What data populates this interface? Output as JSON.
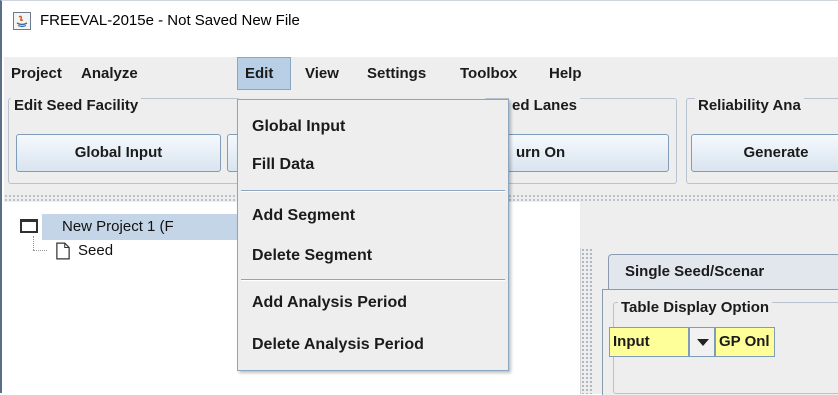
{
  "window": {
    "title": "FREEVAL-2015e - Not Saved New File"
  },
  "menubar": {
    "items": [
      {
        "label": "Project"
      },
      {
        "label": "Analyze"
      },
      {
        "label": "Edit"
      },
      {
        "label": "View"
      },
      {
        "label": "Settings"
      },
      {
        "label": "Toolbox"
      },
      {
        "label": "Help"
      }
    ],
    "active": "Edit"
  },
  "toolbar": {
    "edit_seed_group": {
      "title": "Edit Seed Facility",
      "button": "Global Input"
    },
    "managed_lanes_group": {
      "title": "ed Lanes",
      "button": "urn On"
    },
    "reliability_group": {
      "title": "Reliability Ana",
      "button": "Generate"
    }
  },
  "edit_menu": {
    "items": [
      {
        "label": "Global Input"
      },
      {
        "label": "Fill Data"
      },
      {
        "label": "Add Segment"
      },
      {
        "label": "Delete Segment"
      },
      {
        "label": "Add Analysis Period"
      },
      {
        "label": "Delete Analysis Period"
      }
    ]
  },
  "tree": {
    "project": "New Project 1 (F",
    "seed": "Seed"
  },
  "right_panel": {
    "tab": "Single Seed/Scenar",
    "options_title": "Table Display Option",
    "combo1": "Input",
    "combo2": "GP Onl"
  },
  "colors": {
    "menu_active": "#b8cfe5",
    "tree_selected": "#c5d5e8",
    "combo_yellow": "#ffff99",
    "button_border": "#7f9db9"
  }
}
